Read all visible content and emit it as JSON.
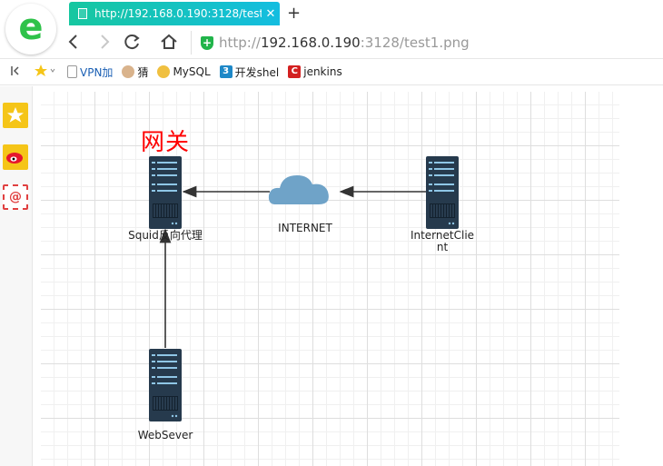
{
  "browser": {
    "tab": {
      "title": "http://192.168.0.190:3128/test1.png",
      "close_label": "✕"
    },
    "new_tab_label": "+",
    "address": {
      "host": "192.168.0.190",
      "rest": ":3128/test1.png",
      "scheme": "http://"
    }
  },
  "bookmarks": [
    {
      "label": "VPN加",
      "icon": "page-icon"
    },
    {
      "label": "猜",
      "icon": "avatar-icon"
    },
    {
      "label": "MySQL",
      "icon": "avatar-icon"
    },
    {
      "label": "开发shel",
      "icon": "app-icon"
    },
    {
      "label": "jenkins",
      "icon": "c-icon"
    }
  ],
  "sidebar": {
    "icons": [
      "star-icon",
      "weibo-icon",
      "mail-icon"
    ]
  },
  "diagram": {
    "gateway_label": "网关",
    "nodes": {
      "squid": "Squid反向代理",
      "internet": "INTERNET",
      "client": "InternetClient",
      "websever": "WebSever"
    },
    "colors": {
      "server": "#263a4d",
      "cloud": "#6fa3c8",
      "gateway": "#ff0000",
      "arrow": "#333333"
    }
  }
}
